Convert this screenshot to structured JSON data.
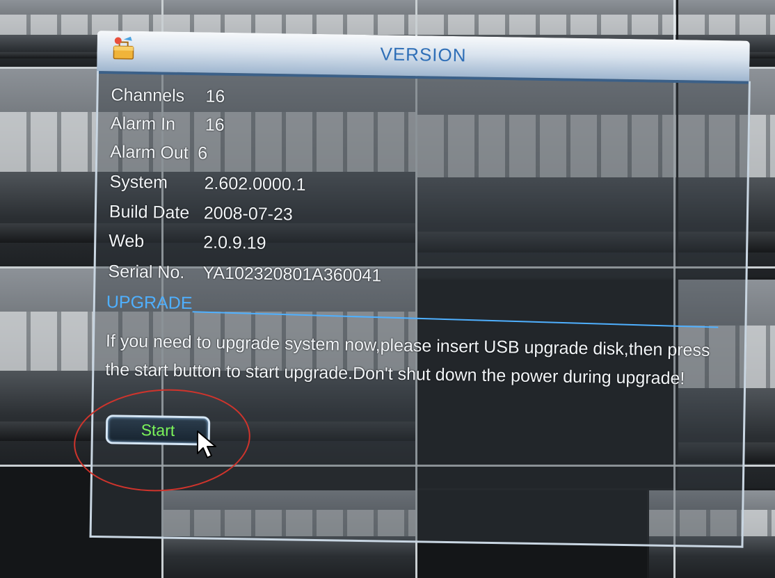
{
  "dialog": {
    "title": "VERSION",
    "info": [
      {
        "label": "Channels",
        "value": "16"
      },
      {
        "label": "Alarm In",
        "value": "16"
      },
      {
        "label": "Alarm Out",
        "value": "6"
      },
      {
        "label": "System",
        "value": "2.602.0000.1"
      },
      {
        "label": "Build Date",
        "value": "2008-07-23"
      },
      {
        "label": "Web",
        "value": "2.0.9.19"
      },
      {
        "label": "Serial No.",
        "value": "YA102320801A360041"
      }
    ],
    "upgrade_section": "UPGRADE",
    "upgrade_message": "If you need to upgrade system now,please insert USB upgrade disk,then press the start button to start upgrade.Don't shut down the power during upgrade!",
    "start_button": "Start"
  },
  "colors": {
    "title_text": "#2f6fb7",
    "section_text": "#4fb0ff",
    "button_text": "#7bf45a",
    "annotation_circle": "#d0342c"
  },
  "icons": {
    "title": "toolbox-icon",
    "pointer": "mouse-cursor-icon"
  }
}
